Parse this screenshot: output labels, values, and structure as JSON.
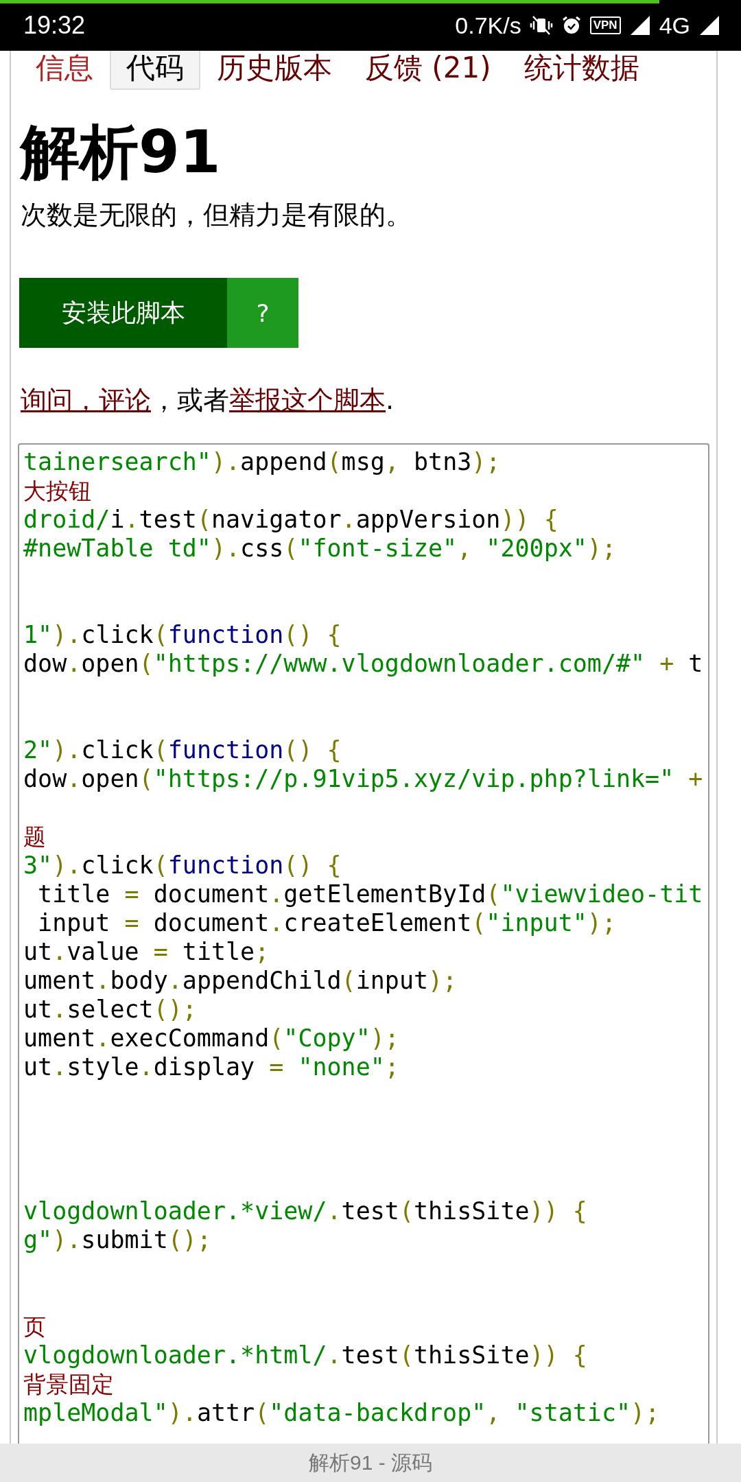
{
  "status_bar": {
    "time": "19:32",
    "speed": "0.7K/s",
    "vpn": "VPN",
    "network": "4G",
    "progress": {
      "level": 0.89
    }
  },
  "tabs": [
    {
      "label": "信息",
      "selected": false,
      "visited": true
    },
    {
      "label": "代码",
      "selected": true,
      "visited": false
    },
    {
      "label": "历史版本",
      "selected": false,
      "visited": false
    },
    {
      "label": "反馈 (21)",
      "selected": false,
      "visited": false
    },
    {
      "label": "统计数据",
      "selected": false,
      "visited": false
    }
  ],
  "title": "解析91",
  "description": "次数是无限的，但精力是有限的。",
  "install_button": "安装此脚本",
  "help_button": "?",
  "feedback_sentence": [
    {
      "text": "询问，评论",
      "link": true
    },
    {
      "text": "，或者",
      "link": false
    },
    {
      "text": "举报这个脚本",
      "link": true
    },
    {
      "text": ".",
      "link": false
    }
  ],
  "code_lines": [
    {
      "kind": "code",
      "segments": [
        {
          "kind": "str",
          "text": "tainersearch\""
        },
        {
          "kind": "punc",
          "text": ")."
        },
        {
          "kind": "plain",
          "text": "append"
        },
        {
          "kind": "punc",
          "text": "("
        },
        {
          "kind": "plain",
          "text": "msg"
        },
        {
          "kind": "punc",
          "text": ", "
        },
        {
          "kind": "plain",
          "text": "btn3"
        },
        {
          "kind": "punc",
          "text": ");"
        }
      ]
    },
    {
      "kind": "code",
      "segments": [
        {
          "kind": "comment",
          "text": "大按钮"
        }
      ]
    },
    {
      "kind": "code",
      "segments": [
        {
          "kind": "str",
          "text": "droid/"
        },
        {
          "kind": "plain",
          "text": "i"
        },
        {
          "kind": "punc",
          "text": "."
        },
        {
          "kind": "plain",
          "text": "test"
        },
        {
          "kind": "punc",
          "text": "("
        },
        {
          "kind": "plain",
          "text": "navigator"
        },
        {
          "kind": "punc",
          "text": "."
        },
        {
          "kind": "plain",
          "text": "appVersion"
        },
        {
          "kind": "punc",
          "text": ")) {"
        }
      ]
    },
    {
      "kind": "code",
      "segments": [
        {
          "kind": "str",
          "text": "#newTable td\""
        },
        {
          "kind": "punc",
          "text": ")."
        },
        {
          "kind": "plain",
          "text": "css"
        },
        {
          "kind": "punc",
          "text": "("
        },
        {
          "kind": "str",
          "text": "\"font-size\""
        },
        {
          "kind": "punc",
          "text": ", "
        },
        {
          "kind": "str",
          "text": "\"200px\""
        },
        {
          "kind": "punc",
          "text": ");"
        }
      ]
    },
    {
      "kind": "blank"
    },
    {
      "kind": "blank"
    },
    {
      "kind": "code",
      "segments": [
        {
          "kind": "str",
          "text": "1\""
        },
        {
          "kind": "punc",
          "text": ")."
        },
        {
          "kind": "plain",
          "text": "click"
        },
        {
          "kind": "punc",
          "text": "("
        },
        {
          "kind": "kw",
          "text": "function"
        },
        {
          "kind": "punc",
          "text": "() {"
        }
      ]
    },
    {
      "kind": "code",
      "segments": [
        {
          "kind": "plain",
          "text": "dow"
        },
        {
          "kind": "punc",
          "text": "."
        },
        {
          "kind": "plain",
          "text": "open"
        },
        {
          "kind": "punc",
          "text": "("
        },
        {
          "kind": "str",
          "text": "\"https://www.vlogdownloader.com/#\""
        },
        {
          "kind": "punc",
          "text": " + "
        },
        {
          "kind": "plain",
          "text": "t"
        }
      ]
    },
    {
      "kind": "blank"
    },
    {
      "kind": "blank"
    },
    {
      "kind": "code",
      "segments": [
        {
          "kind": "str",
          "text": "2\""
        },
        {
          "kind": "punc",
          "text": ")."
        },
        {
          "kind": "plain",
          "text": "click"
        },
        {
          "kind": "punc",
          "text": "("
        },
        {
          "kind": "kw",
          "text": "function"
        },
        {
          "kind": "punc",
          "text": "() {"
        }
      ]
    },
    {
      "kind": "code",
      "segments": [
        {
          "kind": "plain",
          "text": "dow"
        },
        {
          "kind": "punc",
          "text": "."
        },
        {
          "kind": "plain",
          "text": "open"
        },
        {
          "kind": "punc",
          "text": "("
        },
        {
          "kind": "str",
          "text": "\"https://p.91vip5.xyz/vip.php?link=\""
        },
        {
          "kind": "punc",
          "text": " +"
        }
      ]
    },
    {
      "kind": "blank"
    },
    {
      "kind": "code",
      "segments": [
        {
          "kind": "comment",
          "text": "题"
        }
      ]
    },
    {
      "kind": "code",
      "segments": [
        {
          "kind": "str",
          "text": "3\""
        },
        {
          "kind": "punc",
          "text": ")."
        },
        {
          "kind": "plain",
          "text": "click"
        },
        {
          "kind": "punc",
          "text": "("
        },
        {
          "kind": "kw",
          "text": "function"
        },
        {
          "kind": "punc",
          "text": "() {"
        }
      ]
    },
    {
      "kind": "code",
      "segments": [
        {
          "kind": "plain",
          "text": " title"
        },
        {
          "kind": "punc",
          "text": " = "
        },
        {
          "kind": "plain",
          "text": "document"
        },
        {
          "kind": "punc",
          "text": "."
        },
        {
          "kind": "plain",
          "text": "getElementById"
        },
        {
          "kind": "punc",
          "text": "("
        },
        {
          "kind": "str",
          "text": "\"viewvideo-tit"
        }
      ]
    },
    {
      "kind": "code",
      "segments": [
        {
          "kind": "plain",
          "text": " input"
        },
        {
          "kind": "punc",
          "text": " = "
        },
        {
          "kind": "plain",
          "text": "document"
        },
        {
          "kind": "punc",
          "text": "."
        },
        {
          "kind": "plain",
          "text": "createElement"
        },
        {
          "kind": "punc",
          "text": "("
        },
        {
          "kind": "str",
          "text": "\"input\""
        },
        {
          "kind": "punc",
          "text": ");"
        }
      ]
    },
    {
      "kind": "code",
      "segments": [
        {
          "kind": "plain",
          "text": "ut"
        },
        {
          "kind": "punc",
          "text": "."
        },
        {
          "kind": "plain",
          "text": "value"
        },
        {
          "kind": "punc",
          "text": " = "
        },
        {
          "kind": "plain",
          "text": "title"
        },
        {
          "kind": "punc",
          "text": ";"
        }
      ]
    },
    {
      "kind": "code",
      "segments": [
        {
          "kind": "plain",
          "text": "ument"
        },
        {
          "kind": "punc",
          "text": "."
        },
        {
          "kind": "plain",
          "text": "body"
        },
        {
          "kind": "punc",
          "text": "."
        },
        {
          "kind": "plain",
          "text": "appendChild"
        },
        {
          "kind": "punc",
          "text": "("
        },
        {
          "kind": "plain",
          "text": "input"
        },
        {
          "kind": "punc",
          "text": ");"
        }
      ]
    },
    {
      "kind": "code",
      "segments": [
        {
          "kind": "plain",
          "text": "ut"
        },
        {
          "kind": "punc",
          "text": "."
        },
        {
          "kind": "plain",
          "text": "select"
        },
        {
          "kind": "punc",
          "text": "();"
        }
      ]
    },
    {
      "kind": "code",
      "segments": [
        {
          "kind": "plain",
          "text": "ument"
        },
        {
          "kind": "punc",
          "text": "."
        },
        {
          "kind": "plain",
          "text": "execCommand"
        },
        {
          "kind": "punc",
          "text": "("
        },
        {
          "kind": "str",
          "text": "\"Copy\""
        },
        {
          "kind": "punc",
          "text": ");"
        }
      ]
    },
    {
      "kind": "code",
      "segments": [
        {
          "kind": "plain",
          "text": "ut"
        },
        {
          "kind": "punc",
          "text": "."
        },
        {
          "kind": "plain",
          "text": "style"
        },
        {
          "kind": "punc",
          "text": "."
        },
        {
          "kind": "plain",
          "text": "display"
        },
        {
          "kind": "punc",
          "text": " = "
        },
        {
          "kind": "str",
          "text": "\"none\""
        },
        {
          "kind": "punc",
          "text": ";"
        }
      ]
    },
    {
      "kind": "blank"
    },
    {
      "kind": "blank"
    },
    {
      "kind": "blank"
    },
    {
      "kind": "blank"
    },
    {
      "kind": "code",
      "segments": [
        {
          "kind": "str",
          "text": "vlogdownloader.*view/"
        },
        {
          "kind": "punc",
          "text": "."
        },
        {
          "kind": "plain",
          "text": "test"
        },
        {
          "kind": "punc",
          "text": "("
        },
        {
          "kind": "plain",
          "text": "thisSite"
        },
        {
          "kind": "punc",
          "text": ")) {"
        }
      ]
    },
    {
      "kind": "code",
      "segments": [
        {
          "kind": "str",
          "text": "g\""
        },
        {
          "kind": "punc",
          "text": ")."
        },
        {
          "kind": "plain",
          "text": "submit"
        },
        {
          "kind": "punc",
          "text": "();"
        }
      ]
    },
    {
      "kind": "blank"
    },
    {
      "kind": "blank"
    },
    {
      "kind": "code",
      "segments": [
        {
          "kind": "comment",
          "text": "页"
        }
      ]
    },
    {
      "kind": "code",
      "segments": [
        {
          "kind": "str",
          "text": "vlogdownloader.*html/"
        },
        {
          "kind": "punc",
          "text": "."
        },
        {
          "kind": "plain",
          "text": "test"
        },
        {
          "kind": "punc",
          "text": "("
        },
        {
          "kind": "plain",
          "text": "thisSite"
        },
        {
          "kind": "punc",
          "text": ")) {"
        }
      ]
    },
    {
      "kind": "code",
      "segments": [
        {
          "kind": "comment",
          "text": "背景固定"
        }
      ]
    },
    {
      "kind": "code",
      "segments": [
        {
          "kind": "str",
          "text": "mpleModal\""
        },
        {
          "kind": "punc",
          "text": ")."
        },
        {
          "kind": "plain",
          "text": "attr"
        },
        {
          "kind": "punc",
          "text": "("
        },
        {
          "kind": "str",
          "text": "\"data-backdrop\""
        },
        {
          "kind": "punc",
          "text": ", "
        },
        {
          "kind": "str",
          "text": "\"static\""
        },
        {
          "kind": "punc",
          "text": ");"
        }
      ]
    }
  ],
  "footer": "解析91 - 源码"
}
